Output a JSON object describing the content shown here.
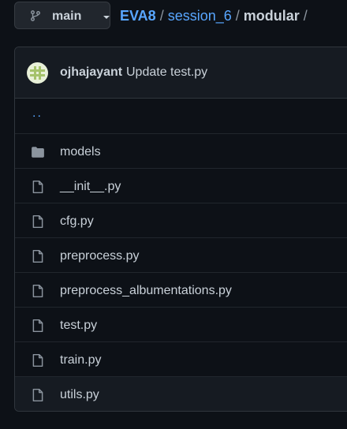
{
  "branch": {
    "icon": "git-branch-icon",
    "label": "main",
    "caret_icon": "caret-down-icon"
  },
  "breadcrumb": {
    "root": "EVA8",
    "separator": "/",
    "folder": "session_6",
    "current": "modular",
    "trailing": "/"
  },
  "commit": {
    "author": "ojhajayant",
    "message": "Update test.py"
  },
  "files": {
    "parent": "..",
    "items": [
      {
        "type": "folder",
        "icon": "folder-icon",
        "name": "models"
      },
      {
        "type": "file",
        "icon": "file-icon",
        "name": "__init__.py"
      },
      {
        "type": "file",
        "icon": "file-icon",
        "name": "cfg.py"
      },
      {
        "type": "file",
        "icon": "file-icon",
        "name": "preprocess.py"
      },
      {
        "type": "file",
        "icon": "file-icon",
        "name": "preprocess_albumentations.py"
      },
      {
        "type": "file",
        "icon": "file-icon",
        "name": "test.py"
      },
      {
        "type": "file",
        "icon": "file-icon",
        "name": "train.py"
      },
      {
        "type": "file",
        "icon": "file-icon",
        "name": "utils.py"
      }
    ]
  },
  "colors": {
    "background": "#0d1117",
    "link": "#58a6ff",
    "text": "#c9d1d9",
    "icon": "#8b949e"
  }
}
